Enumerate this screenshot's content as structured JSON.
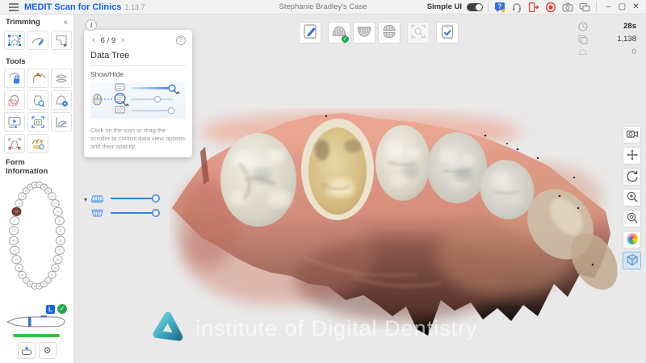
{
  "titlebar": {
    "app_name": "MEDIT Scan for Clinics",
    "version": "1.13.7",
    "case_title": "Stephanie Bradley's Case",
    "simple_ui_label": "Simple UI",
    "simple_ui_on": true,
    "system_icons": [
      {
        "name": "help-chat-icon"
      },
      {
        "name": "remote-support-icon"
      },
      {
        "name": "exit-session-icon"
      },
      {
        "name": "record-icon"
      },
      {
        "name": "screen-capture-icon"
      },
      {
        "name": "dual-monitor-icon"
      }
    ],
    "window_controls": [
      {
        "name": "minimize-button",
        "glyph": "–"
      },
      {
        "name": "maximize-button",
        "glyph": "▢"
      },
      {
        "name": "close-button",
        "glyph": "✕"
      }
    ]
  },
  "sidebar": {
    "trimming": {
      "title": "Trimming",
      "collapse_glyph": "«",
      "tools": [
        {
          "name": "polygon-selection",
          "icon": "polygon-selection"
        },
        {
          "name": "curve-trim",
          "icon": "curve-trim"
        },
        {
          "name": "area-trim",
          "icon": "area-trim"
        }
      ]
    },
    "tools": {
      "title": "Tools",
      "items": [
        {
          "name": "lock-data",
          "icon": "lock-data"
        },
        {
          "name": "color-analysis",
          "icon": "color-analysis"
        },
        {
          "name": "occlusion-analysis",
          "icon": "occlusion-analysis"
        },
        {
          "name": "region-select",
          "icon": "region-select"
        },
        {
          "name": "crown-check",
          "icon": "crown-check"
        },
        {
          "name": "arch-adjust",
          "icon": "arch-adjust"
        },
        {
          "name": "replay",
          "icon": "replay"
        },
        {
          "name": "screenshot",
          "icon": "screenshot"
        },
        {
          "name": "margin-line",
          "icon": "margin-line"
        },
        {
          "name": "hd-capture",
          "icon": "hd-capture"
        },
        {
          "name": "smile-preview",
          "icon": "smile-preview"
        }
      ]
    },
    "form_information": {
      "title": "Form Information",
      "upper_teeth": [
        "18",
        "17",
        "16",
        "15",
        "14",
        "13",
        "12",
        "11",
        "21",
        "22",
        "23",
        "24",
        "25",
        "26",
        "27",
        "28"
      ],
      "lower_teeth": [
        "48",
        "47",
        "46",
        "45",
        "44",
        "43",
        "42",
        "41",
        "31",
        "32",
        "33",
        "34",
        "35",
        "36",
        "37",
        "38"
      ],
      "highlighted_tooth": "16",
      "highlight_color": "#7a4034"
    },
    "scanner": {
      "badge": "L",
      "check_glyph": "✓",
      "status": "connected",
      "battery_color": "#2fc63c",
      "buttons": [
        {
          "name": "scanner-calibration",
          "icon": "calibration"
        },
        {
          "name": "scanner-settings",
          "icon": "gear"
        }
      ]
    }
  },
  "viewport": {
    "guide_popup": {
      "info_glyph": "i",
      "prev_glyph": "‹",
      "page": "6 / 9",
      "next_glyph": "›",
      "help_glyph": "?",
      "title": "Data Tree",
      "subtitle": "Show/Hide",
      "caption": "Click on the icon or drag the scroller to control data view options and their opacity."
    },
    "scan_toolbar": [
      {
        "name": "edit-form",
        "icon": "edit-form",
        "state": "normal"
      },
      {
        "name": "maxilla-scan",
        "icon": "maxilla",
        "state": "done"
      },
      {
        "name": "mandible-scan",
        "icon": "mandible",
        "state": "normal"
      },
      {
        "name": "occlusion-scan",
        "icon": "occlusion-stage",
        "state": "normal"
      },
      {
        "name": "ai-scan",
        "icon": "ai-scan",
        "state": "disabled"
      },
      {
        "name": "complete-scan",
        "icon": "complete",
        "state": "normal"
      }
    ],
    "stats": [
      {
        "name": "scan-time",
        "icon": "clock",
        "value": "28s"
      },
      {
        "name": "frame-count",
        "icon": "frames",
        "value": "1,138"
      },
      {
        "name": "extra-count",
        "icon": "arch-mini",
        "value": "0"
      }
    ],
    "data_tree": {
      "collapse_glyph": "▾",
      "rows": [
        {
          "name": "maxilla-layer",
          "icon": "upper-arch-mini",
          "opacity": 100
        },
        {
          "name": "mandible-layer",
          "icon": "lower-arch-mini",
          "opacity": 100
        }
      ]
    },
    "view_toolbar": [
      {
        "name": "viewport-capture",
        "icon": "camera-view",
        "selected": false
      },
      {
        "name": "pan-tool",
        "icon": "pan",
        "selected": false
      },
      {
        "name": "rotate-tool",
        "icon": "rotate",
        "selected": false
      },
      {
        "name": "zoom-tool",
        "icon": "zoom-in",
        "selected": false
      },
      {
        "name": "zoom-fit-tool",
        "icon": "zoom-fit",
        "selected": false
      },
      {
        "name": "color-mode-tool",
        "icon": "color-sphere",
        "selected": false
      },
      {
        "name": "box-view-tool",
        "icon": "box-view",
        "selected": true
      }
    ],
    "watermark": {
      "text": "institute of Digital Dentistry"
    }
  }
}
